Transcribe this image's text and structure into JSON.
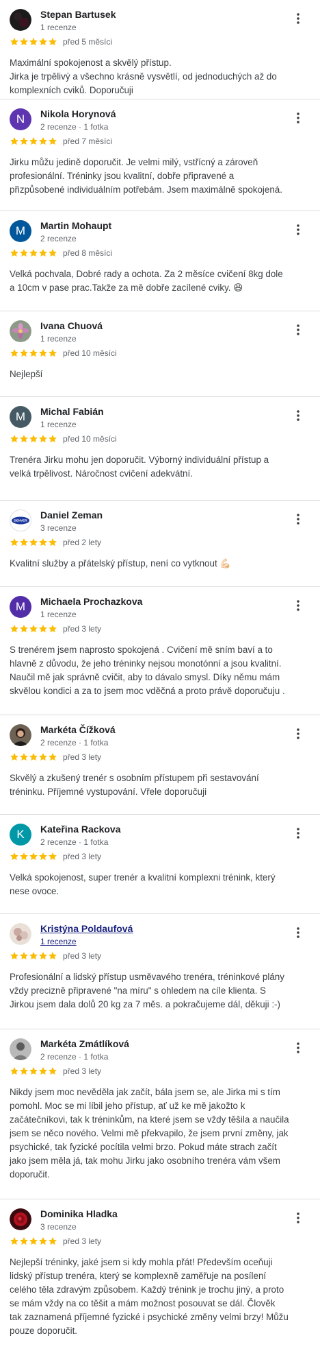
{
  "colors": {
    "star": "#fbbc04",
    "divider": "#dadce0",
    "muted": "#5f6368",
    "text": "#3c4043"
  },
  "reviews": [
    {
      "name": "Stepan Bartusek",
      "meta": "1 recenze",
      "stars": 5,
      "date": "před 5 měsíci",
      "text": "Maximální spokojenost a skvělý přístup.\nJirka je trpělivý a všechno krásně vysvětlí, od jednoduchých až do komplexních cviků. Doporučuji",
      "avatar": {
        "type": "photo-dark"
      }
    },
    {
      "name": "Nikola Horynová",
      "meta": "2 recenze · 1 fotka",
      "stars": 5,
      "date": "před 7 měsíci",
      "text": "Jirku můžu jedině doporučit. Je velmi milý, vstřícný a zároveň profesionální. Tréninky jsou kvalitní, dobře připravené a přizpůsobené individuálním potřebám. Jsem maximálně spokojená.",
      "avatar": {
        "type": "letter",
        "letter": "N",
        "color": "#5e35b1"
      }
    },
    {
      "name": "Martin Mohaupt",
      "meta": "2 recenze",
      "stars": 5,
      "date": "před 8 měsíci",
      "text": "Velká pochvala, Dobré rady a ochota. Za 2 měsíce cvičení 8kg dole a 10cm v pase prac.Takže za mě dobře zacílené cviky. 😆",
      "avatar": {
        "type": "letter",
        "letter": "M",
        "color": "#01579b"
      }
    },
    {
      "name": "Ivana Chuová",
      "meta": "1 recenze",
      "stars": 5,
      "date": "před 10 měsíci",
      "text": "Nejlepší",
      "avatar": {
        "type": "photo-flower"
      }
    },
    {
      "name": "Michal Fabián",
      "meta": "1 recenze",
      "stars": 5,
      "date": "před 10 měsíci",
      "text": "Trenéra Jirku mohu jen doporučit. Výborný individuální přístup a velká trpělivost. Náročnost cvičení adekvátní.",
      "avatar": {
        "type": "letter",
        "letter": "M",
        "color": "#455a64"
      }
    },
    {
      "name": "Daniel Zeman",
      "meta": "3 recenze",
      "stars": 5,
      "date": "před 2 lety",
      "text": "Kvalitní služby a přátelský přístup, není co vytknout 💪🏻",
      "avatar": {
        "type": "logo",
        "text": "DENVER"
      }
    },
    {
      "name": "Michaela Prochazkova",
      "meta": "1 recenze",
      "stars": 5,
      "date": "před 3 lety",
      "text": "S trenérem jsem naprosto spokojená . Cvičení mě sním baví a to hlavně z důvodu, že jeho tréninky nejsou monotónní a jsou kvalitní. Naučil mě jak správně cvičit, aby to dávalo smysl. Díky němu mám skvělou kondici a za to jsem moc vděčná a proto právě doporučuju .",
      "avatar": {
        "type": "letter",
        "letter": "M",
        "color": "#512da8"
      }
    },
    {
      "name": "Markéta Čížková",
      "meta": "2 recenze · 1 fotka",
      "stars": 5,
      "date": "před 3 lety",
      "text": "Skvělý a zkušený trenér s osobním přístupem při sestavování tréninku. Příjemné vystupování. Vřele doporučuji",
      "avatar": {
        "type": "photo-person"
      }
    },
    {
      "name": "Kateřina Rackova",
      "meta": "2 recenze · 1 fotka",
      "stars": 5,
      "date": "před 3 lety",
      "text": "Velká spokojenost, super trenér a kvalitní komplexni trénink, který nese ovoce.",
      "avatar": {
        "type": "letter",
        "letter": "K",
        "color": "#0097a7"
      }
    },
    {
      "name": "Kristýna Poldaufová",
      "meta": "1 recenze",
      "stars": 5,
      "date": "před 3 lety",
      "text": "Profesionální a lidský přístup usměvavého trenéra, tréninkové plány vždy precizně připravené \"na míru\" s ohledem na cíle klienta. S Jirkou jsem dala dolů 20 kg za 7 měs. a pokračujeme dál, děkuji :-)",
      "avatar": {
        "type": "photo-light"
      },
      "hovered": true
    },
    {
      "name": "Markéta Zmátlíková",
      "meta": "2 recenze · 1 fotka",
      "stars": 5,
      "date": "před 3 lety",
      "text": "Nikdy jsem moc nevěděla jak začít, bála jsem se, ale Jirka mi s tím pomohl. Moc se mi líbil jeho přístup, ať už ke mě jakožto k začátečníkovi, tak k tréninkům, na které jsem se vždy těšila a naučila jsem se něco nového. Velmi mě překvapilo, že jsem první změny, jak psychické, tak fyzické pocítila velmi brzo. Pokud máte strach začít jako jsem měla já, tak mohu Jirku jako osobního trenéra vám všem doporučit.",
      "avatar": {
        "type": "photo-gray"
      }
    },
    {
      "name": "Dominika Hladka",
      "meta": "3 recenze",
      "stars": 5,
      "date": "před 3 lety",
      "text": "Nejlepší tréninky, jaké jsem si kdy mohla přát! Především oceňuji lidský přístup trenéra, který se komplexně zaměřuje na posílení celého těla zdravým způsobem. Každý trénink je trochu jiný, a proto se mám vždy na co těšit a mám možnost posouvat se dál. Člověk tak zaznamená příjemné fyzické i psychické změny velmi brzy! Můžu pouze doporučit.",
      "avatar": {
        "type": "photo-rose"
      }
    }
  ]
}
